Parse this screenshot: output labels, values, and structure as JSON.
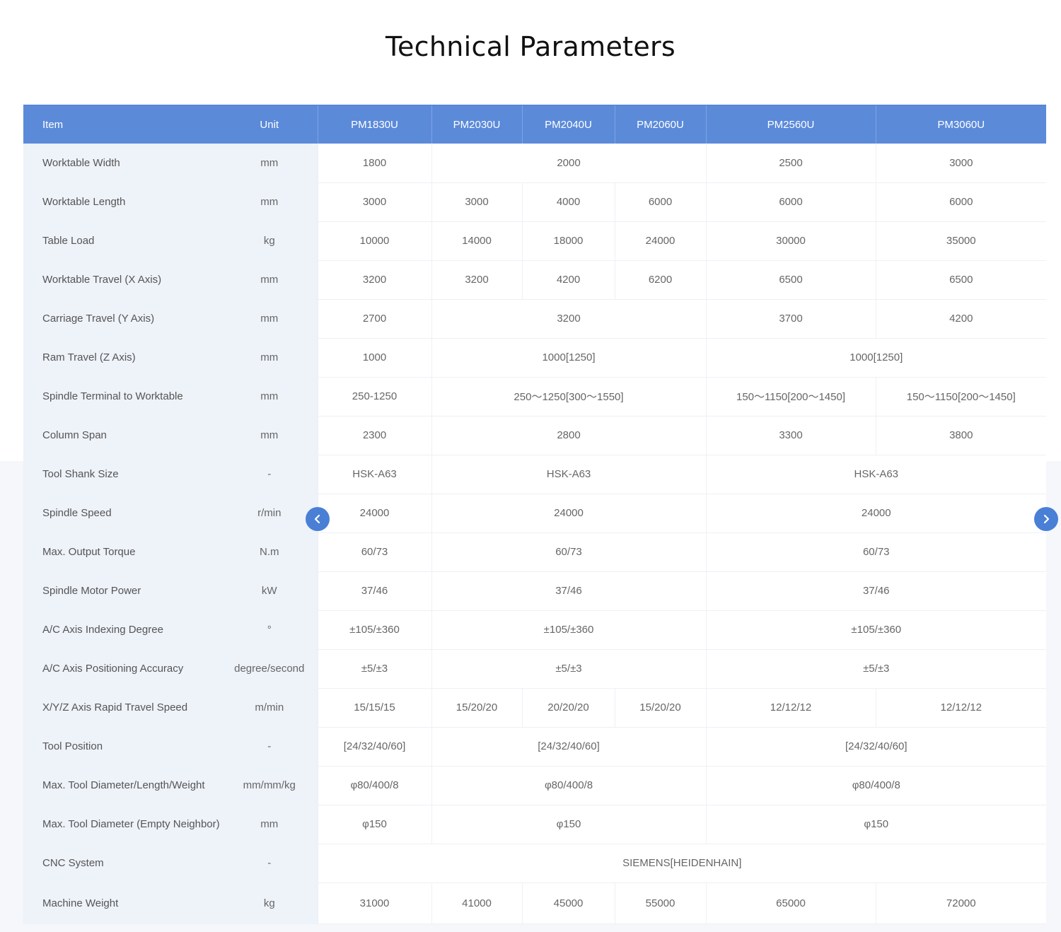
{
  "page": {
    "title": "Technical Parameters"
  },
  "table": {
    "headers": [
      "Item",
      "Unit",
      "PM1830U",
      "PM2030U",
      "PM2040U",
      "PM2060U",
      "PM2560U",
      "PM3060U"
    ],
    "rows": [
      {
        "item": "Worktable  Width",
        "unit": "mm",
        "cells": [
          {
            "v": "1800"
          },
          {
            "v": "2000",
            "span": 3
          },
          {
            "v": "2500"
          },
          {
            "v": "3000"
          }
        ]
      },
      {
        "item": "Worktable Length",
        "unit": "mm",
        "cells": [
          {
            "v": "3000"
          },
          {
            "v": "3000"
          },
          {
            "v": "4000"
          },
          {
            "v": "6000"
          },
          {
            "v": "6000"
          },
          {
            "v": "6000"
          }
        ]
      },
      {
        "item": "Table Load",
        "unit": "kg",
        "cells": [
          {
            "v": "10000"
          },
          {
            "v": "14000"
          },
          {
            "v": "18000"
          },
          {
            "v": "24000"
          },
          {
            "v": "30000"
          },
          {
            "v": "35000"
          }
        ]
      },
      {
        "item": "Worktable Travel (X Axis)",
        "unit": "mm",
        "cells": [
          {
            "v": "3200"
          },
          {
            "v": "3200"
          },
          {
            "v": "4200"
          },
          {
            "v": "6200"
          },
          {
            "v": "6500"
          },
          {
            "v": "6500"
          }
        ]
      },
      {
        "item": "Carriage Travel (Y Axis)",
        "unit": "mm",
        "cells": [
          {
            "v": "2700"
          },
          {
            "v": "3200",
            "span": 3
          },
          {
            "v": "3700"
          },
          {
            "v": "4200"
          }
        ]
      },
      {
        "item": "Ram Travel (Z Axis)",
        "unit": "mm",
        "cells": [
          {
            "v": "1000"
          },
          {
            "v": "1000[1250]",
            "span": 3
          },
          {
            "v": "1000[1250]",
            "span": 2
          }
        ]
      },
      {
        "item": "Spindle Terminal to Worktable",
        "unit": "mm",
        "cells": [
          {
            "v": "250-1250"
          },
          {
            "v": "250～1250[300～1550]",
            "span": 3
          },
          {
            "v": "150～1150[200～1450]"
          },
          {
            "v": "150～1150[200～1450]"
          }
        ]
      },
      {
        "item": "Column Span",
        "unit": "mm",
        "cells": [
          {
            "v": "2300"
          },
          {
            "v": "2800",
            "span": 3
          },
          {
            "v": "3300"
          },
          {
            "v": "3800"
          }
        ]
      },
      {
        "item": "Tool Shank Size",
        "unit": "-",
        "cells": [
          {
            "v": "HSK-A63"
          },
          {
            "v": "HSK-A63",
            "span": 3
          },
          {
            "v": "HSK-A63",
            "span": 2
          }
        ]
      },
      {
        "item": "Spindle Speed",
        "unit": "r/min",
        "cells": [
          {
            "v": "24000"
          },
          {
            "v": "24000",
            "span": 3
          },
          {
            "v": "24000",
            "span": 2
          }
        ]
      },
      {
        "item": "Max. Output Torque",
        "unit": "N.m",
        "cells": [
          {
            "v": "60/73"
          },
          {
            "v": "60/73",
            "span": 3
          },
          {
            "v": "60/73",
            "span": 2
          }
        ]
      },
      {
        "item": "Spindle Motor Power",
        "unit": "kW",
        "cells": [
          {
            "v": "37/46"
          },
          {
            "v": "37/46",
            "span": 3
          },
          {
            "v": "37/46",
            "span": 2
          }
        ]
      },
      {
        "item": "A/C Axis Indexing Degree",
        "unit": "°",
        "cells": [
          {
            "v": "±105/±360"
          },
          {
            "v": "±105/±360",
            "span": 3
          },
          {
            "v": "±105/±360",
            "span": 2
          }
        ]
      },
      {
        "item": "A/C Axis Positioning Accuracy",
        "unit": "degree/second",
        "cells": [
          {
            "v": "±5/±3"
          },
          {
            "v": "±5/±3",
            "span": 3
          },
          {
            "v": "±5/±3",
            "span": 2
          }
        ]
      },
      {
        "item": "X/Y/Z Axis Rapid Travel Speed",
        "unit": "m/min",
        "cells": [
          {
            "v": "15/15/15"
          },
          {
            "v": "15/20/20"
          },
          {
            "v": "20/20/20"
          },
          {
            "v": "15/20/20"
          },
          {
            "v": "12/12/12"
          },
          {
            "v": "12/12/12"
          }
        ]
      },
      {
        "item": "Tool Position",
        "unit": "-",
        "cells": [
          {
            "v": "[24/32/40/60]"
          },
          {
            "v": "[24/32/40/60]",
            "span": 3
          },
          {
            "v": "[24/32/40/60]",
            "span": 2
          }
        ]
      },
      {
        "item": "Max. Tool Diameter/Length/Weight",
        "unit": "mm/mm/kg",
        "cells": [
          {
            "v": "φ80/400/8"
          },
          {
            "v": "φ80/400/8",
            "span": 3
          },
          {
            "v": "φ80/400/8",
            "span": 2
          }
        ]
      },
      {
        "item": "Max. Tool Diameter (Empty Neighbor)",
        "unit": "mm",
        "cells": [
          {
            "v": "φ150"
          },
          {
            "v": "φ150",
            "span": 3
          },
          {
            "v": "φ150",
            "span": 2
          }
        ]
      },
      {
        "item": "CNC System",
        "unit": "-",
        "cells": [
          {
            "v": "SIEMENS[HEIDENHAIN]",
            "span": 6
          }
        ]
      },
      {
        "item": "Machine Weight",
        "unit": "kg",
        "cells": [
          {
            "v": "31000"
          },
          {
            "v": "41000"
          },
          {
            "v": "45000"
          },
          {
            "v": "55000"
          },
          {
            "v": "65000"
          },
          {
            "v": "72000"
          }
        ]
      }
    ]
  },
  "nav": {
    "prev_icon": "chevron-left-icon",
    "next_icon": "chevron-right-icon"
  },
  "colors": {
    "header_bg": "#5b8ad9",
    "nav_button": "#4a7fd6",
    "label_bg": "#eef2f9"
  }
}
